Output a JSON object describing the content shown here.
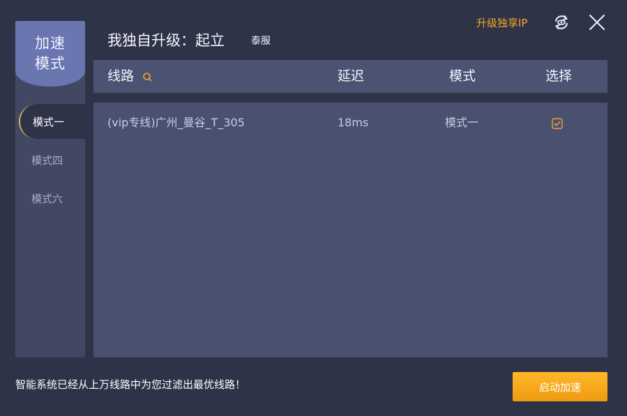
{
  "sidebar": {
    "header_title": "加速模式",
    "items": [
      {
        "label": "模式一",
        "active": true
      },
      {
        "label": "模式四",
        "active": false
      },
      {
        "label": "模式六",
        "active": false
      }
    ]
  },
  "header": {
    "title": "我独自升级：起立",
    "region": "泰服",
    "upgrade_link": "升级独享IP",
    "refresh_icon": "refresh-eye-icon",
    "close_icon": "close-icon"
  },
  "table": {
    "columns": [
      "线路",
      "延迟",
      "模式",
      "选择"
    ],
    "search_icon": "search-icon",
    "rows": [
      {
        "route": "(vip专线)广州_曼谷_T_305",
        "latency": "18ms",
        "mode": "模式一",
        "selected": true
      }
    ]
  },
  "footer": {
    "status": "智能系统已经从上万线路中为您过滤出最优线路！",
    "start_button": "启动加速"
  },
  "colors": {
    "accent": "#f5a623",
    "sidebar_header": "#6a76b0",
    "panel": "#495070",
    "background": "#2f3347"
  }
}
